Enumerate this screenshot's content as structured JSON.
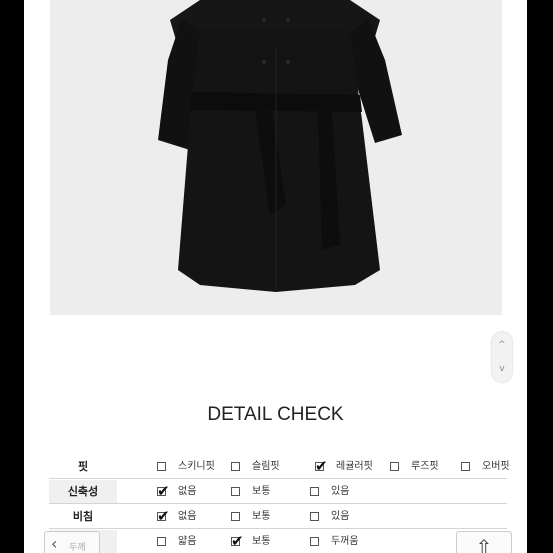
{
  "detail": {
    "heading": "DETAIL CHECK",
    "rows": [
      {
        "label": "핏",
        "options": [
          {
            "text": "스키니핏",
            "checked": false
          },
          {
            "text": "슬림핏",
            "checked": false
          },
          {
            "text": "레귤러핏",
            "checked": true
          },
          {
            "text": "루즈핏",
            "checked": false
          },
          {
            "text": "오버핏",
            "checked": false
          }
        ]
      },
      {
        "label": "신축성",
        "options": [
          {
            "text": "없음",
            "checked": true
          },
          {
            "text": "보통",
            "checked": false
          },
          {
            "text": "있음",
            "checked": false
          }
        ]
      },
      {
        "label": "비침",
        "options": [
          {
            "text": "없음",
            "checked": true
          },
          {
            "text": "보통",
            "checked": false
          },
          {
            "text": "있음",
            "checked": false
          }
        ]
      },
      {
        "label": "두께",
        "options": [
          {
            "text": "얇음",
            "checked": false
          },
          {
            "text": "보통",
            "checked": true
          },
          {
            "text": "두꺼움",
            "checked": false
          }
        ]
      }
    ]
  },
  "nav": {
    "prev_glyph": "‹",
    "prev_label": "두께",
    "top_glyph": "⇧"
  },
  "scroll": {
    "up": "^",
    "down": "v"
  },
  "colors": {
    "photo_bg": "#ededed",
    "coat": "#141414",
    "frame": "#000000"
  },
  "icons": {
    "check": "check-mark-icon",
    "nav_prev": "chevron-left-icon",
    "nav_top": "arrow-up-icon"
  }
}
